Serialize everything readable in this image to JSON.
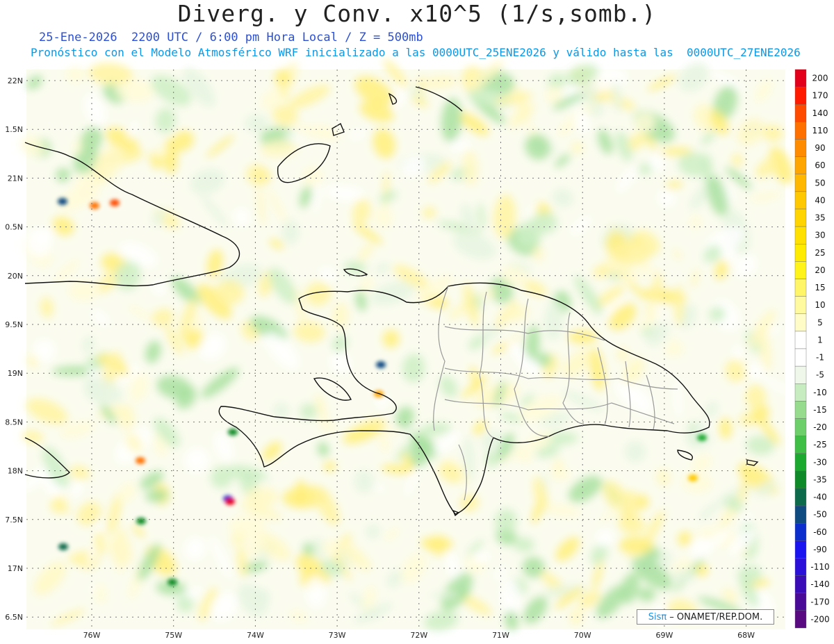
{
  "title": "Diverg. y Conv. x10^5 (1/s,somb.)",
  "subtitle_time": "25-Ene-2026  2200 UTC / 6:00 pm Hora Local / Z = 500mb",
  "subtitle_model": "Pronóstico con el Modelo Atmosférico WRF inicializado a las 0000UTC_25ENE2026 y válido hasta las  0000UTC_27ENE2026",
  "lat_labels": [
    "22N",
    "1.5N",
    "21N",
    "0.5N",
    "20N",
    "9.5N",
    "19N",
    "8.5N",
    "18N",
    "7.5N",
    "17N",
    "6.5N"
  ],
  "lon_labels": [
    "76W",
    "75W",
    "74W",
    "73W",
    "72W",
    "71W",
    "70W",
    "69W",
    "68W"
  ],
  "colorbar": {
    "labels": [
      "200",
      "170",
      "140",
      "110",
      "90",
      "60",
      "50",
      "40",
      "35",
      "30",
      "25",
      "20",
      "15",
      "10",
      "5",
      "1",
      "-1",
      "-5",
      "-10",
      "-15",
      "-20",
      "-25",
      "-30",
      "-35",
      "-40",
      "-50",
      "-60",
      "-90",
      "-110",
      "-140",
      "-170",
      "-200"
    ],
    "colors": [
      "#e3001b",
      "#ff1a00",
      "#ff4a00",
      "#ff7000",
      "#ff8c00",
      "#ffa500",
      "#ffb700",
      "#ffc800",
      "#ffd400",
      "#ffe000",
      "#ffeb00",
      "#fff31a",
      "#fff566",
      "#fff9a0",
      "#fffcc8",
      "#ffffff",
      "#ffffff",
      "#eef7ea",
      "#c6ecc0",
      "#96db8e",
      "#6ccf6a",
      "#3fbf46",
      "#1ca930",
      "#0f8a28",
      "#0d6b4c",
      "#0f4a80",
      "#0c2ecc",
      "#1a14f0",
      "#2a10d8",
      "#3a0cb8",
      "#4a0a98",
      "#5a0a80"
    ]
  },
  "credit": {
    "sis": "Sisπ",
    "org": "– ONAMET/REP.DOM."
  }
}
